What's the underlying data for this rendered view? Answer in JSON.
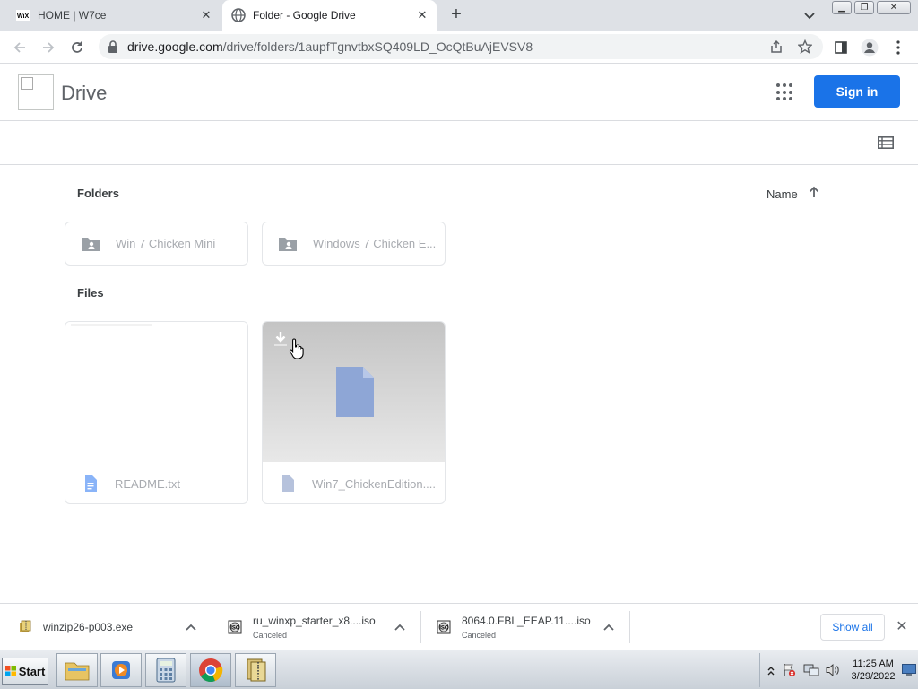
{
  "browser": {
    "tabs": [
      {
        "title": "HOME | W7ce",
        "favicon": "wix-logo-icon",
        "active": false
      },
      {
        "title": "Folder - Google Drive",
        "favicon": "globe-icon",
        "active": true
      }
    ],
    "new_tab_label": "+",
    "url_host": "drive.google.com",
    "url_path": "/drive/folders/1aupfTgnvtbxSQ409LD_OcQtBuAjEVSV8",
    "window_buttons": [
      "minimize",
      "restore",
      "close"
    ]
  },
  "drive": {
    "app_name": "Drive",
    "signin_label": "Sign in",
    "sections": {
      "folders_label": "Folders",
      "files_label": "Files"
    },
    "sort": {
      "label": "Name",
      "direction_icon": "arrow-up-icon"
    },
    "folders": [
      {
        "name": "Win 7 Chicken Mini",
        "icon": "shared-folder-icon"
      },
      {
        "name": "Windows 7 Chicken E...",
        "icon": "shared-folder-icon"
      }
    ],
    "files": [
      {
        "name": "README.txt",
        "icon": "text-document-icon",
        "thumbnail": "blank"
      },
      {
        "name": "Win7_ChickenEdition....",
        "icon": "generic-file-icon",
        "thumbnail": "file-placeholder",
        "hover_action": "download-icon"
      }
    ]
  },
  "downloads": {
    "items": [
      {
        "name": "winzip26-p003.exe",
        "status": "",
        "icon": "winzip-icon"
      },
      {
        "name": "ru_winxp_starter_x8....iso",
        "status": "Canceled",
        "icon": "iso-disc-icon"
      },
      {
        "name": "8064.0.FBL_EEAP.11....iso",
        "status": "Canceled",
        "icon": "iso-disc-icon"
      }
    ],
    "show_all_label": "Show all"
  },
  "taskbar": {
    "start_label": "Start",
    "apps": [
      "file-explorer-icon",
      "media-player-icon",
      "calculator-icon",
      "chrome-icon",
      "archive-icon"
    ],
    "time": "11:25 AM",
    "date": "3/29/2022"
  },
  "colors": {
    "accent": "#1a73e8",
    "tab_strip": "#dee1e6",
    "muted_text": "#a8abb0"
  }
}
